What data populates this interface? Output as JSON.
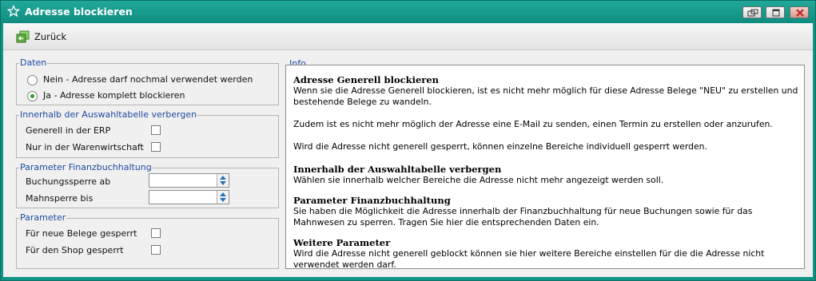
{
  "window": {
    "title": "Adresse blockieren",
    "title_icon": "star-icon",
    "controls": [
      "restore-icon",
      "maximize-icon",
      "close-icon"
    ]
  },
  "toolbar": {
    "back_label": "Zurück",
    "back_icon": "back-arrow-icon"
  },
  "daten": {
    "legend": "Daten",
    "options": [
      {
        "label": "Nein - Adresse darf nochmal verwendet werden",
        "selected": false
      },
      {
        "label": "Ja - Adresse komplett blockieren",
        "selected": true
      }
    ]
  },
  "auswahl": {
    "legend": "Innerhalb der Auswahltabelle verbergen",
    "items": [
      {
        "label": "Generell in der ERP",
        "checked": false
      },
      {
        "label": "Nur in der Warenwirtschaft",
        "checked": false
      }
    ]
  },
  "fibu": {
    "legend": "Parameter Finanzbuchhaltung",
    "fields": [
      {
        "label": "Buchungssperre ab",
        "value": ""
      },
      {
        "label": "Mahnsperre bis",
        "value": ""
      }
    ]
  },
  "parameter": {
    "legend": "Parameter",
    "items": [
      {
        "label": "Für neue Belege gesperrt",
        "checked": false
      },
      {
        "label": "Für den Shop gesperrt",
        "checked": false
      }
    ]
  },
  "info": {
    "legend": "Info",
    "sections": [
      {
        "heading": "Adresse Generell blockieren",
        "paragraphs": [
          "Wenn sie die Adresse Generell blockieren, ist es nicht mehr möglich für diese Adresse Belege \"NEU\" zu erstellen und bestehende Belege zu wandeln.",
          "Zudem ist es nicht mehr möglich der Adresse eine E-Mail zu senden, einen Termin zu erstellen oder anzurufen.",
          "Wird die Adresse nicht generell gesperrt, können einzelne Bereiche individuell gesperrt werden."
        ]
      },
      {
        "heading": "Innerhalb der Auswahltabelle verbergen",
        "paragraphs": [
          "Wählen sie innerhalb welcher Bereiche die Adresse nicht mehr angezeigt werden soll."
        ]
      },
      {
        "heading": "Parameter Finanzbuchhaltung",
        "paragraphs": [
          "Sie haben die Möglichkeit die Adresse innerhalb der Finanzbuchhaltung für neue Buchungen sowie für das Mahnwesen zu sperren. Tragen Sie hier die entsprechenden Daten ein."
        ]
      },
      {
        "heading": "Weitere Parameter",
        "paragraphs": [
          "Wird die Adresse nicht generell geblockt können sie hier weitere Bereiche einstellen für die die Adresse nicht verwendet werden darf."
        ]
      }
    ]
  },
  "colors": {
    "titlebar": "#129487",
    "legend_text": "#1c4ba0",
    "radio_dot": "#2d9a2d"
  }
}
